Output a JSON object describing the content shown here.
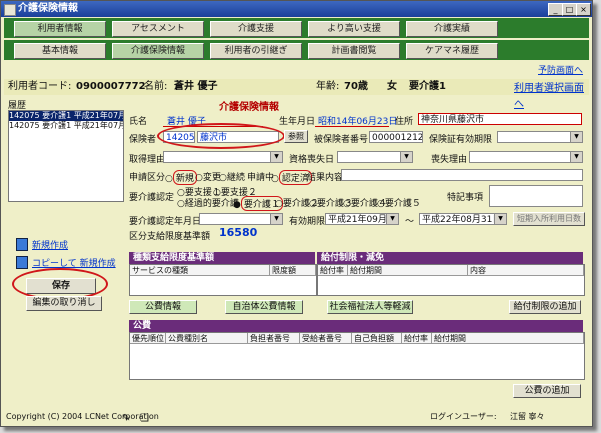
{
  "window": {
    "title": "介護保険情報",
    "min": "_",
    "max": "□",
    "close": "×"
  },
  "nav1": [
    "利用者情報",
    "アセスメント",
    "介護支援",
    "より高い支援",
    "介護実績"
  ],
  "nav2": [
    "基本情報",
    "介護保険情報",
    "利用者の引継ぎ",
    "計画書閲覧",
    "ケアマネ履歴"
  ],
  "links": {
    "prev": "予防画面へ",
    "select_user": "利用者選択画面へ"
  },
  "user": {
    "code_label": "利用者コード:",
    "code": "0900007772",
    "name_label": "名前:",
    "name": "蒼井 優子",
    "age_label": "年齢:",
    "age": "70歳",
    "sex": "女",
    "care_level": "要介護1"
  },
  "history": {
    "label": "履歴",
    "items": [
      "142075 要介護1 平成21年07月01日",
      "142075 要介護1 平成21年07月01日"
    ]
  },
  "left_actions": {
    "new": "新規作成",
    "copy_new": "コピーして 新規作成",
    "save": "保存",
    "cancel_edit": "編集の取り消し"
  },
  "form": {
    "heading": "介護保険情報",
    "name_label": "氏名",
    "name_value": "蒼井 優子",
    "birth_label": "生年月日",
    "birth_value": "昭和14年06月23日",
    "address_label": "住所",
    "address_value": "神奈川県藤沢市",
    "insurer_label": "保険者",
    "insurer_code": "142059",
    "insurer_name": "藤沢市",
    "ref_button": "参照",
    "insured_no_label": "被保険者番号",
    "insured_no": "0000012121",
    "cert_period_label": "保険証有効期限",
    "acquire_label": "取得理由",
    "lost_date_label": "資格喪失日",
    "lost_reason_label": "喪失理由",
    "app_label": "申請区分",
    "app_options": [
      "新規",
      "変更",
      "継続"
    ],
    "applying_label": "申請中",
    "cert_done": "認定済",
    "result_label": "結果内容",
    "care_cert_label": "要介護認定",
    "support_levels": [
      "要支援１",
      "要支援２"
    ],
    "transitional": "経過的要介護",
    "care_levels": [
      "要介護１",
      "要介護２",
      "要介護３",
      "要介護４",
      "要介護５"
    ],
    "special_label": "特記事項",
    "cert_date_label": "要介護認定年月日",
    "valid_label": "有効期限",
    "valid_from": "平成21年09月01日",
    "tilde": "～",
    "valid_to": "平成22年08月31日",
    "short_stay_button": "短期入所利用日数",
    "limit_label": "区分支給限度基準額",
    "limit_value": "16580"
  },
  "kinds_section": {
    "title": "種類支給限度基準額",
    "cols": [
      "サービスの種類",
      "限度額"
    ]
  },
  "restrict_section": {
    "title": "給付制限・減免",
    "cols": [
      "給付率",
      "給付期間",
      "内容"
    ]
  },
  "tabs": [
    "公費情報",
    "自治体公費情報",
    "社会福祉法人等軽減"
  ],
  "add_restrict": "給付制限の追加",
  "public_section": {
    "title": "公費",
    "cols": [
      "優先順位",
      "公費種別名",
      "負担者番号",
      "受給者番号",
      "自己負担額",
      "給付率",
      "給付期間"
    ]
  },
  "add_public": "公費の追加",
  "footer": {
    "copyright": "Copyright (C) 2004 LCNet Corporation",
    "login_label": "ログインユーザー:",
    "login_user": "江留 寧々"
  }
}
